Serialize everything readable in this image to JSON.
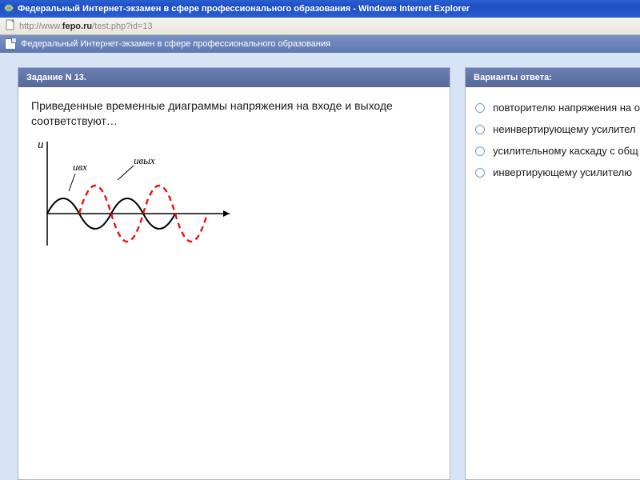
{
  "browser": {
    "window_title": "Федеральный Интернет-экзамен в сфере профессионального образования - Windows Internet Explorer",
    "url_prefix": "http://www.",
    "url_host": "fepo.ru",
    "url_path": "/test.php?id=13"
  },
  "page_header": "Федеральный Интернет-экзамен в сфере профессионального образования",
  "question": {
    "header": "Задание N 13.",
    "text": "Приведенные временные диаграммы напряжения на входе и выходе соответствуют…",
    "axis_label": "u",
    "label_in": "uвх",
    "label_out": "uвых"
  },
  "answers": {
    "header": "Варианты ответа:",
    "options": [
      "повторителю напряжения на о",
      "неинвертирующему усилител",
      "усилительному каскаду с общ",
      "инвертирующему усилителю"
    ]
  }
}
